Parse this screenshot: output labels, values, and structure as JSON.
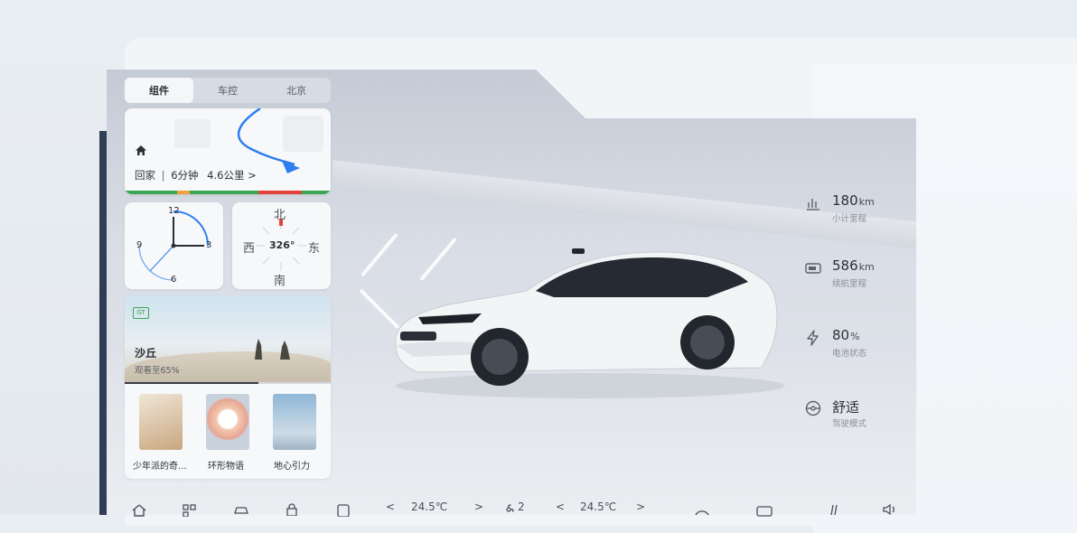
{
  "tabs": [
    {
      "label": "组件",
      "active": true
    },
    {
      "label": "车控",
      "active": false
    },
    {
      "label": "北京",
      "active": false
    }
  ],
  "navigation": {
    "destination": "回家",
    "separator": "|",
    "eta": "6分钟",
    "distance": "4.6公里",
    "arrow": ">",
    "icon": "home-icon"
  },
  "clock": {
    "n12": "12",
    "n3": "3",
    "n6": "6",
    "n9": "9"
  },
  "compass": {
    "north": "北",
    "south": "南",
    "east": "东",
    "west": "西",
    "heading": "326°"
  },
  "media": {
    "badge": "GT",
    "title": "沙丘",
    "progress_text": "观看至65%",
    "progress": 0.65,
    "items": [
      {
        "label": "少年派的奇..."
      },
      {
        "label": "环形物语"
      },
      {
        "label": "地心引力"
      }
    ]
  },
  "stats": [
    {
      "icon": "bar-chart-icon",
      "value": "180",
      "unit": "km",
      "label": "小计里程"
    },
    {
      "icon": "battery-range-icon",
      "value": "586",
      "unit": "km",
      "label": "续航里程"
    },
    {
      "icon": "lightning-icon",
      "value": "80",
      "unit": "%",
      "label": "电池状态"
    },
    {
      "icon": "steering-wheel-icon",
      "value": "舒适",
      "unit": "",
      "label": "驾驶模式"
    }
  ],
  "dock": {
    "left_temp": "24.5℃",
    "fan_level": "2",
    "right_temp": "24.5℃",
    "chev_left": "<",
    "chev_right": ">"
  },
  "colors": {
    "nav_route": "#2d7ef0",
    "clock_arc": "#2d7ef0",
    "compass_marker": "#e2433a",
    "traffic_green": "#3aa655",
    "traffic_orange": "#f0a23a",
    "traffic_red": "#e2433a"
  }
}
